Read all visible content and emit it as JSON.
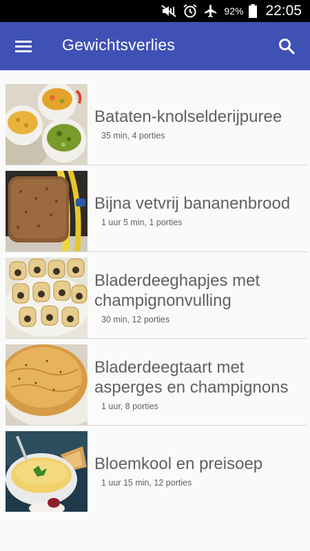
{
  "status_bar": {
    "battery_percent": "92%",
    "time": "22:05"
  },
  "app_bar": {
    "title": "Gewichtsverlies",
    "background_color": "#3f51b5"
  },
  "recipes": [
    {
      "title": "Bataten-knolselderijpuree",
      "meta": "35 min, 4 porties",
      "image": "bowls of mashed puree"
    },
    {
      "title": "Bijna vetvrij bananenbrood",
      "meta": "1 uur 5 min, 1 porties",
      "image": "banana bread loaf with bananas"
    },
    {
      "title": "Bladerdeeghapjes met champignonvulling",
      "meta": "30 min, 12 porties",
      "image": "puff pastry rolls"
    },
    {
      "title": "Bladerdeegtaart met asperges en champignons",
      "meta": "1 uur, 8 porties",
      "image": "puff pastry pie"
    },
    {
      "title": "Bloemkool en preisoep",
      "meta": "1 uur 15 min, 12 porties",
      "image": "bowl of creamy soup"
    }
  ]
}
